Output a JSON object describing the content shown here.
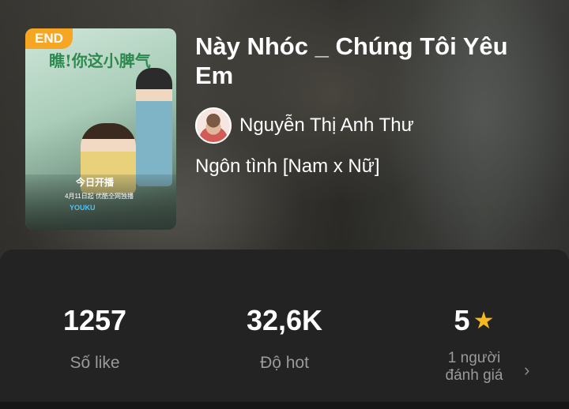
{
  "book": {
    "status_badge": "END",
    "title": "Này Nhóc _ Chúng Tôi Yêu Em",
    "author": "Nguyễn Thị Anh Thư",
    "genre": "Ngôn tình [Nam x Nữ]",
    "cover": {
      "title_text": "瞧!你这小脾气",
      "tag_text": "今日开播",
      "date_text": "4月11日起 优酷全网独播",
      "brand_text": "YOUKU"
    }
  },
  "stats": {
    "likes": {
      "value": "1257",
      "label": "Số like"
    },
    "hot": {
      "value": "32,6K",
      "label": "Độ hot"
    },
    "rating": {
      "value": "5",
      "raters_line1": "1 người",
      "raters_line2": "đánh giá"
    }
  },
  "icons": {
    "star": "star-icon",
    "chevron": "chevron-right-icon"
  },
  "colors": {
    "badge": "#f6a623",
    "star": "#f6b81f",
    "panel": "#232323"
  }
}
